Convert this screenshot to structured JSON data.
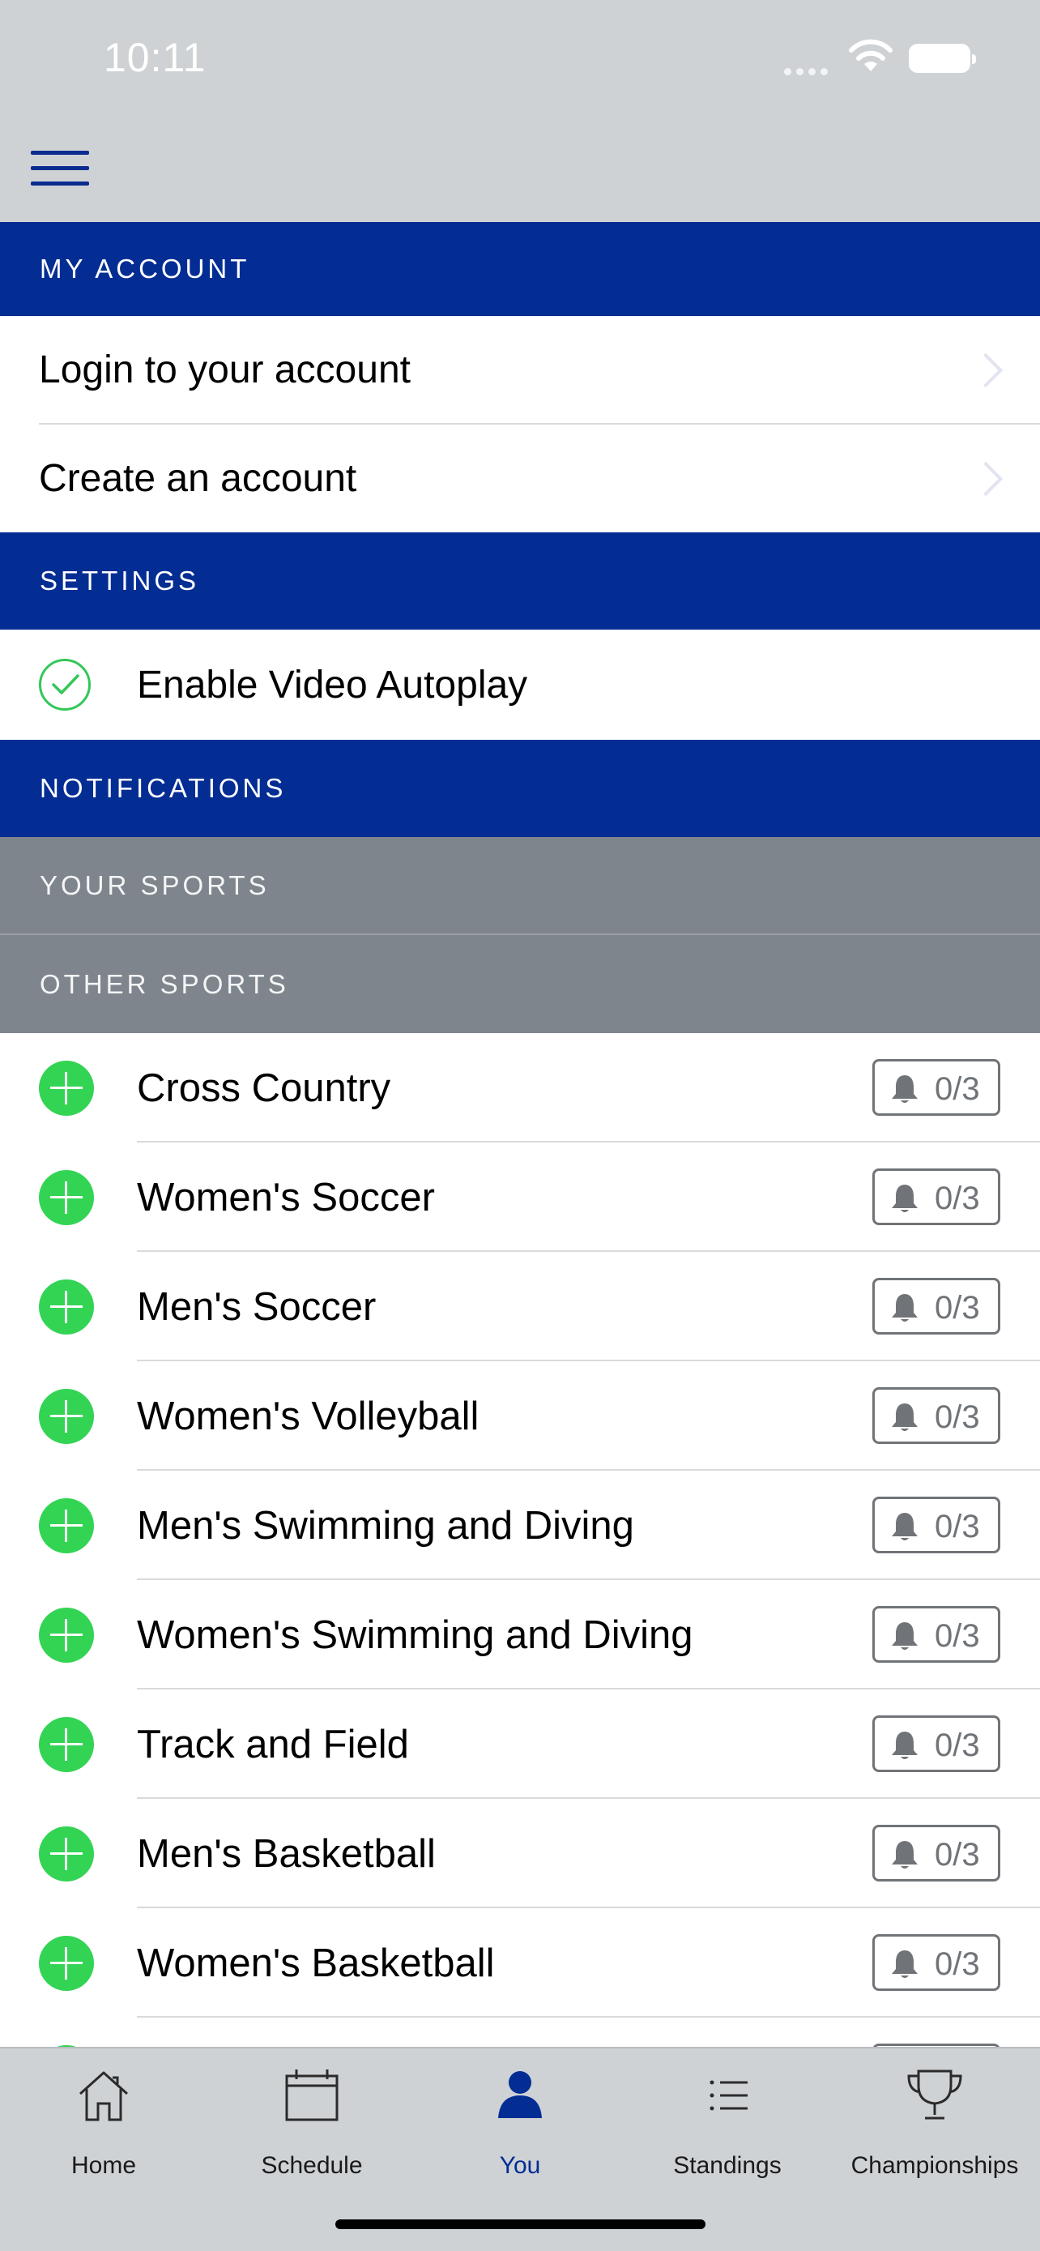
{
  "status_bar": {
    "time": "10:11"
  },
  "sections": {
    "my_account": "MY ACCOUNT",
    "settings": "SETTINGS",
    "notifications": "NOTIFICATIONS",
    "your_sports": "YOUR SPORTS",
    "other_sports": "OTHER SPORTS"
  },
  "account": {
    "login": "Login to your account",
    "create": "Create an account"
  },
  "settings": {
    "autoplay": "Enable Video Autoplay",
    "autoplay_enabled": true
  },
  "sports": [
    {
      "name": "Cross Country",
      "alerts": "0/3"
    },
    {
      "name": "Women's Soccer",
      "alerts": "0/3"
    },
    {
      "name": "Men's Soccer",
      "alerts": "0/3"
    },
    {
      "name": "Women's Volleyball",
      "alerts": "0/3"
    },
    {
      "name": "Men's Swimming and Diving",
      "alerts": "0/3"
    },
    {
      "name": "Women's Swimming and Diving",
      "alerts": "0/3"
    },
    {
      "name": "Track and Field",
      "alerts": "0/3"
    },
    {
      "name": "Men's Basketball",
      "alerts": "0/3"
    },
    {
      "name": "Women's Basketball",
      "alerts": "0/3"
    }
  ],
  "tabs": [
    {
      "label": "Home",
      "icon": "house-icon"
    },
    {
      "label": "Schedule",
      "icon": "calendar-icon"
    },
    {
      "label": "You",
      "icon": "person-icon",
      "active": true
    },
    {
      "label": "Standings",
      "icon": "list-icon"
    },
    {
      "label": "Championships",
      "icon": "trophy-icon"
    }
  ],
  "colors": {
    "primary_blue": "#042d94",
    "gray_header": "#7f858c",
    "bar_gray": "#cfd2d5",
    "green": "#33d454"
  }
}
